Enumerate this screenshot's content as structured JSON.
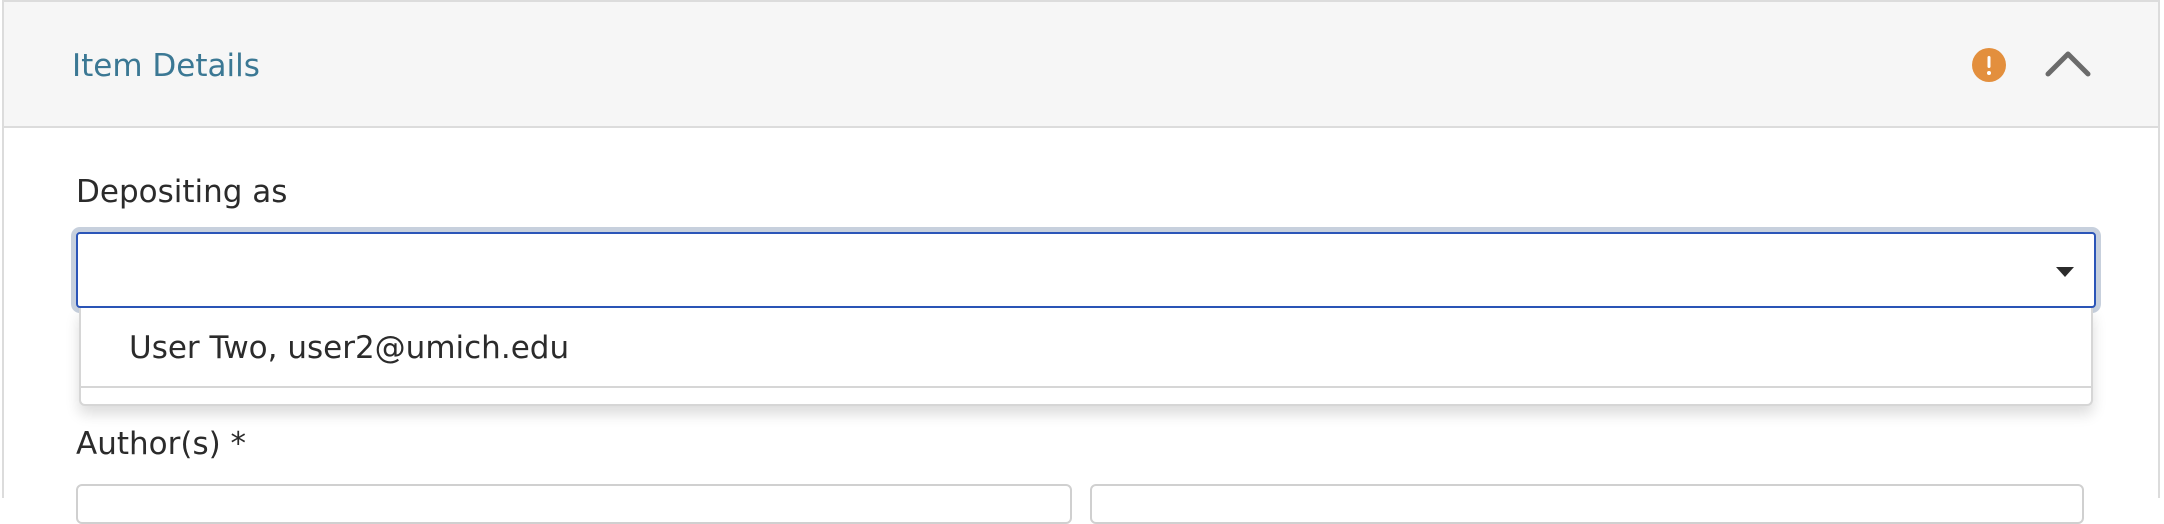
{
  "section": {
    "title": "Item Details"
  },
  "fields": {
    "depositing_as": {
      "label": "Depositing as",
      "selected_value": "",
      "options": [
        "User Two, user2@umich.edu"
      ]
    },
    "authors": {
      "label": "Author(s) *"
    }
  },
  "colors": {
    "title": "#3b7894",
    "warning": "#e38f3d",
    "focus_border": "#2b55b8",
    "header_bg": "#f6f6f6"
  },
  "icons": {
    "warning": "exclamation-circle",
    "collapse": "chevron-up",
    "select_caret": "caret-down"
  }
}
